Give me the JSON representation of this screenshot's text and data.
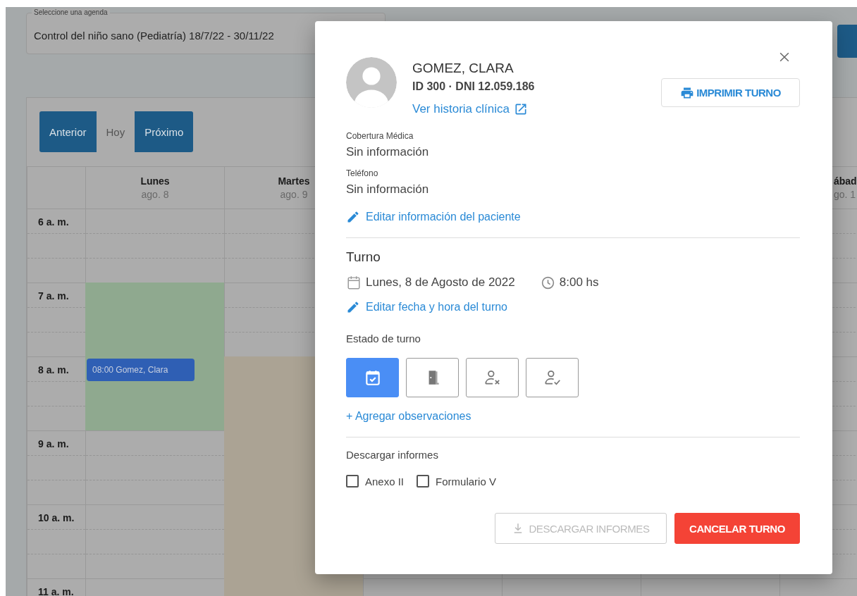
{
  "agenda_select": {
    "label": "Seleccione una agenda",
    "value": "Control del niño sano (Pediatría) 18/7/22 - 30/11/22"
  },
  "calendar": {
    "nav_buttons": [
      {
        "label": "Anterior",
        "kind": "primary"
      },
      {
        "label": "Hoy",
        "kind": "secondary"
      },
      {
        "label": "Próximo",
        "kind": "primary"
      }
    ],
    "days": [
      {
        "name": "Lunes",
        "date": "ago. 8"
      },
      {
        "name": "Martes",
        "date": "ago. 9"
      },
      {
        "name": "ábad",
        "date": "go. 1"
      }
    ],
    "hours": [
      "6 a. m.",
      "7 a. m.",
      "8 a. m.",
      "9 a. m.",
      "10 a. m.",
      "11 a. m."
    ],
    "availability": [
      {
        "color": "#8fa98f"
      },
      {
        "color": "#aba394"
      }
    ],
    "events": [
      {
        "label": "08:00 Gomez, Clara",
        "color": "#2f5fb4"
      }
    ]
  },
  "modal": {
    "patient": {
      "name": "GOMEZ, CLARA",
      "ids": "ID 300 · DNI 12.059.186",
      "history_link": "Ver historia clínica"
    },
    "print_button": "IMPRIMIR TURNO",
    "fields": [
      {
        "label": "Cobertura Médica",
        "value": "Sin información"
      },
      {
        "label": "Teléfono",
        "value": "Sin información"
      }
    ],
    "edit_patient_link": "Editar información del paciente",
    "turno": {
      "title": "Turno",
      "date": "Lunes, 8 de Agosto de 2022",
      "time": "8:00 hs",
      "edit_link": "Editar fecha y hora del turno"
    },
    "status": {
      "label": "Estado de turno",
      "options": [
        {
          "kind": "scheduled",
          "selected": true
        },
        {
          "kind": "arrived",
          "selected": false
        },
        {
          "kind": "absent",
          "selected": false
        },
        {
          "kind": "attended",
          "selected": false
        }
      ]
    },
    "observations_link": "+ Agregar observaciones",
    "reports": {
      "title": "Descargar informes",
      "options": [
        {
          "label": "Anexo II",
          "checked": false
        },
        {
          "label": "Formulario V",
          "checked": false
        }
      ]
    },
    "actions": [
      {
        "label": "DESCARGAR INFORMES",
        "kind": "download",
        "disabled": true
      },
      {
        "label": "CANCELAR TURNO",
        "kind": "danger",
        "disabled": false
      }
    ]
  }
}
